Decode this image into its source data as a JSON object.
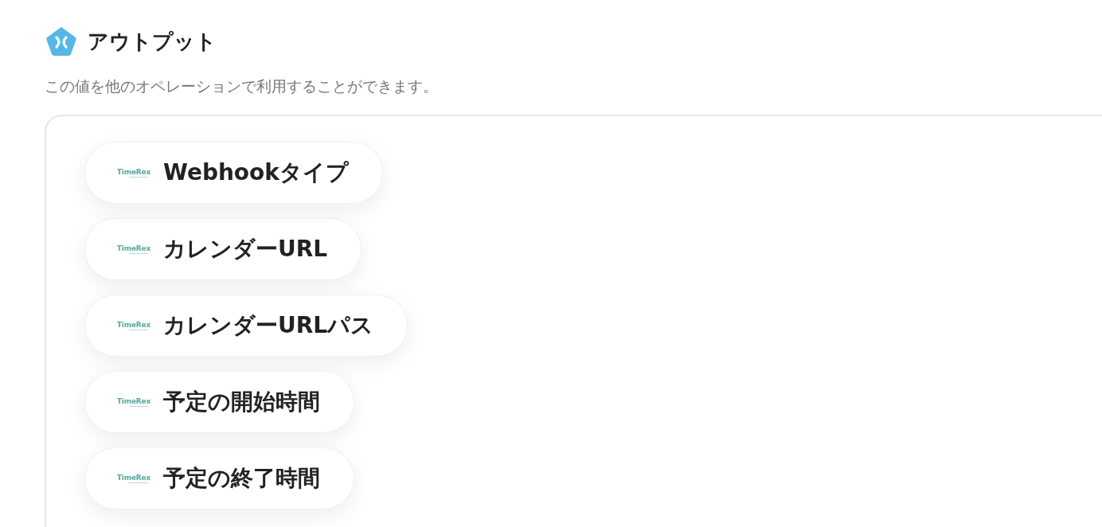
{
  "section": {
    "title": "アウトプット",
    "description": "この値を他のオペレーションで利用することができます。"
  },
  "outputs": [
    {
      "logo": "TimeRex",
      "label": "Webhookタイプ"
    },
    {
      "logo": "TimeRex",
      "label": "カレンダーURL"
    },
    {
      "logo": "TimeRex",
      "label": "カレンダーURLパス"
    },
    {
      "logo": "TimeRex",
      "label": "予定の開始時間"
    },
    {
      "logo": "TimeRex",
      "label": "予定の終了時間"
    }
  ]
}
